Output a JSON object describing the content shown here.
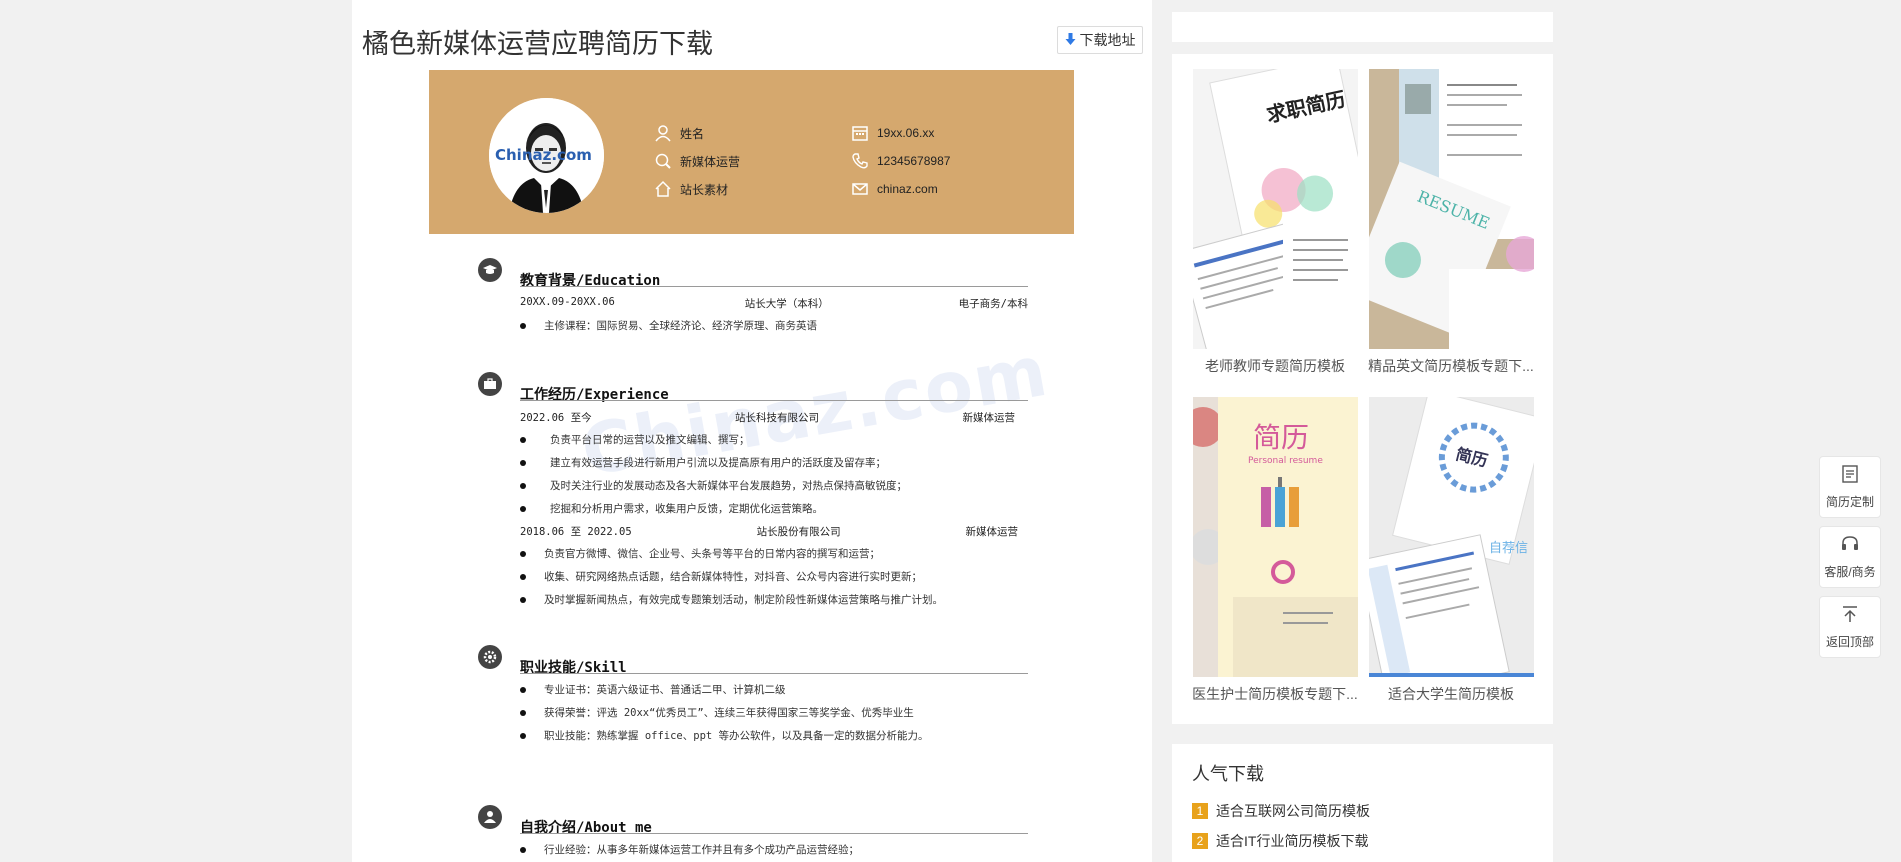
{
  "page": {
    "title": "橘色新媒体运营应聘简历下载",
    "download_label": "下载地址"
  },
  "resume": {
    "avatar_watermark": "Chinaz.com",
    "header": {
      "name": "姓名",
      "position": "新媒体运营",
      "site": "站长素材",
      "birthday": "19xx.06.xx",
      "phone": "12345678987",
      "email": "chinaz.com"
    },
    "watermark": "Chinaz.com",
    "sections": {
      "education": {
        "title": "教育背景/Education",
        "date": "20XX.09-20XX.06",
        "school": "站长大学（本科）",
        "major": "电子商务/本科",
        "bullets": [
          "主修课程：国际贸易、全球经济论、经济学原理、商务英语"
        ]
      },
      "experience": {
        "title": "工作经历/Experience",
        "job1": {
          "date": "2022.06 至今",
          "company": "站长科技有限公司",
          "role": "新媒体运营"
        },
        "job1_bullets": [
          "负责平台日常的运营以及推文编辑、撰写；",
          "建立有效运营手段进行新用户引流以及提高原有用户的活跃度及留存率；",
          "及时关注行业的发展动态及各大新媒体平台发展趋势，对热点保持高敏锐度；",
          "挖掘和分析用户需求，收集用户反馈，定期优化运营策略。"
        ],
        "job2": {
          "date": "2018.06 至 2022.05",
          "company": "站长股份有限公司",
          "role": "新媒体运营"
        },
        "job2_bullets": [
          "负责官方微博、微信、企业号、头条号等平台的日常内容的撰写和运营；",
          "收集、研究网络热点话题，结合新媒体特性，对抖音、公众号内容进行实时更新；",
          "及时掌握新闻热点，有效完成专题策划活动，制定阶段性新媒体运营策略与推广计划。"
        ]
      },
      "skill": {
        "title": "职业技能/Skill",
        "bullets": [
          "专业证书：英语六级证书、普通话二甲、计算机二级",
          "获得荣誉：评选 20xx“优秀员工”、连续三年获得国家三等奖学金、优秀毕业生",
          "职业技能：熟练掌握 office、ppt 等办公软件，以及具备一定的数据分析能力。"
        ]
      },
      "about": {
        "title": "自我介绍/About me",
        "bullets": [
          "行业经验：从事多年新媒体运营工作并且有多个成功产品运营经验；"
        ]
      }
    }
  },
  "sidebar": {
    "thumbs": [
      {
        "label": "老师教师专题简历模板",
        "title_text": "求职简历"
      },
      {
        "label": "精品英文简历模板专题下...",
        "title_text": "RESUME"
      },
      {
        "label": "医生护士简历模板专题下...",
        "title_text": "简历",
        "subtitle_text": "Personal resume"
      },
      {
        "label": "适合大学生简历模板",
        "title_text": "简历",
        "badge_text": "自荐信"
      }
    ],
    "popular": {
      "title": "人气下载",
      "items": [
        {
          "num": "1",
          "label": "适合互联网公司简历模板"
        },
        {
          "num": "2",
          "label": "适合IT行业简历模板下载"
        }
      ]
    }
  },
  "float_tools": [
    {
      "label": "简历定制",
      "icon": "edit-resume-icon"
    },
    {
      "label": "客服/商务",
      "icon": "headset-icon"
    },
    {
      "label": "返回顶部",
      "icon": "arrow-up-icon"
    }
  ],
  "colors": {
    "resume_header": "#d5a86e",
    "accent_blue": "#2f7ae5",
    "popular_badge": "#e8a21b"
  }
}
